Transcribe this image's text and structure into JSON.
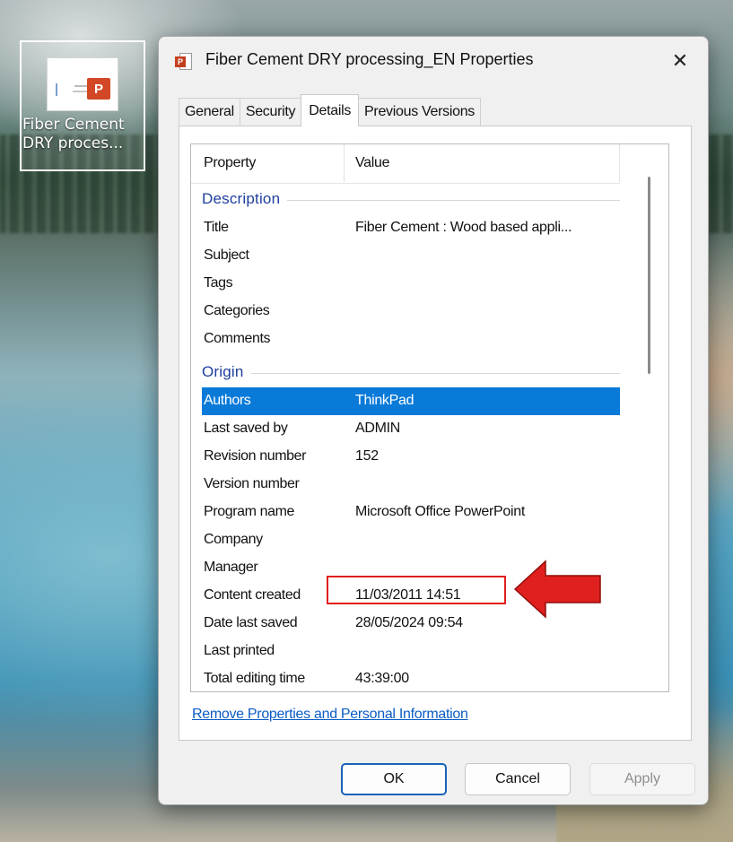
{
  "desktop": {
    "icon_label": "Fiber Cement DRY proces...",
    "icon_badge": "P"
  },
  "dialog": {
    "title": "Fiber Cement DRY processing_EN Properties",
    "close_glyph": "✕",
    "tabs": [
      {
        "label": "General"
      },
      {
        "label": "Security"
      },
      {
        "label": "Details",
        "active": true
      },
      {
        "label": "Previous Versions"
      }
    ],
    "columns": {
      "property": "Property",
      "value": "Value"
    },
    "groups": {
      "description": "Description",
      "origin": "Origin"
    },
    "description_rows": [
      {
        "property": "Title",
        "value": "Fiber Cement  : Wood based appli..."
      },
      {
        "property": "Subject",
        "value": ""
      },
      {
        "property": "Tags",
        "value": ""
      },
      {
        "property": "Categories",
        "value": ""
      },
      {
        "property": "Comments",
        "value": ""
      }
    ],
    "origin_rows": [
      {
        "property": "Authors",
        "value": "ThinkPad",
        "selected": true
      },
      {
        "property": "Last saved by",
        "value": "ADMIN"
      },
      {
        "property": "Revision number",
        "value": "152"
      },
      {
        "property": "Version number",
        "value": ""
      },
      {
        "property": "Program name",
        "value": "Microsoft Office PowerPoint"
      },
      {
        "property": "Company",
        "value": ""
      },
      {
        "property": "Manager",
        "value": ""
      },
      {
        "property": "Content created",
        "value": "11/03/2011 14:51",
        "highlighted": true
      },
      {
        "property": "Date last saved",
        "value": "28/05/2024 09:54"
      },
      {
        "property": "Last printed",
        "value": ""
      },
      {
        "property": "Total editing time",
        "value": "43:39:00"
      }
    ],
    "remove_link": "Remove Properties and Personal Information",
    "buttons": {
      "ok": "OK",
      "cancel": "Cancel",
      "apply": "Apply"
    }
  },
  "colors": {
    "selection": "#0a7ad9",
    "group_label": "#1e3f9e",
    "link": "#0b5cc4",
    "annotation": "#e0201e"
  }
}
